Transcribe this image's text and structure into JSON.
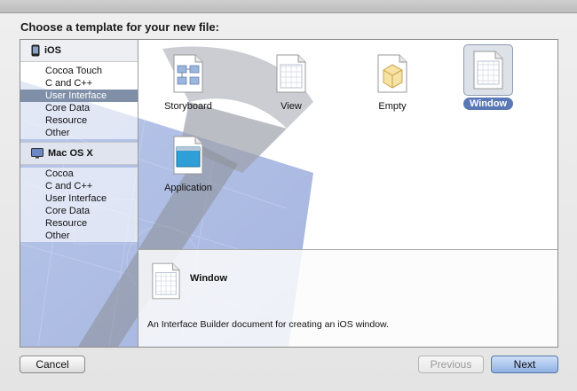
{
  "dialog": {
    "prompt": "Choose a template for your new file:"
  },
  "sidebar": {
    "groups": [
      {
        "label": "iOS",
        "items": [
          "Cocoa Touch",
          "C and C++",
          "User Interface",
          "Core Data",
          "Resource",
          "Other"
        ],
        "selected": "User Interface"
      },
      {
        "label": "Mac OS X",
        "items": [
          "Cocoa",
          "C and C++",
          "User Interface",
          "Core Data",
          "Resource",
          "Other"
        ]
      }
    ]
  },
  "templates": [
    {
      "label": "Storyboard",
      "icon": "storyboard-icon"
    },
    {
      "label": "View",
      "icon": "view-icon"
    },
    {
      "label": "Empty",
      "icon": "empty-icon"
    },
    {
      "label": "Window",
      "icon": "window-icon",
      "selected": true
    },
    {
      "label": "Application",
      "icon": "application-icon"
    }
  ],
  "detail": {
    "title": "Window",
    "description": "An Interface Builder document for creating an iOS window."
  },
  "buttons": {
    "cancel": "Cancel",
    "previous": "Previous",
    "next": "Next"
  },
  "colors": {
    "selection_sidebar": "#7f8fa8",
    "selection_label": "#5a78b6",
    "next_button": "#8fb1e2"
  }
}
